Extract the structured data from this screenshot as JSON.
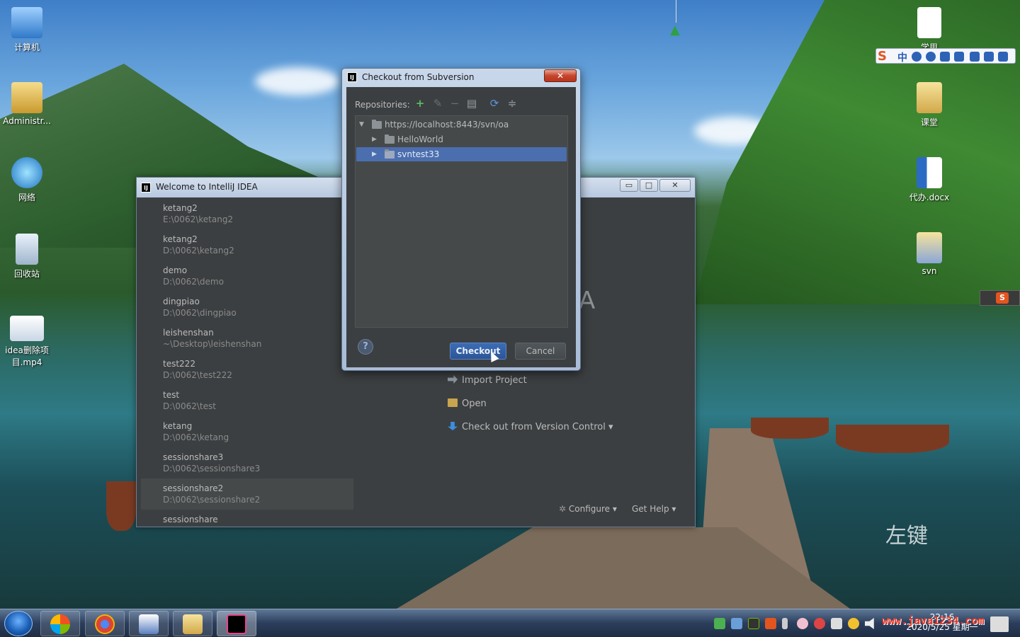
{
  "desktop": {
    "icons": [
      {
        "label": "计算机"
      },
      {
        "label": "Administr..."
      },
      {
        "label": "网络"
      },
      {
        "label": "回收站"
      },
      {
        "label": "idea删除项目.mp4"
      },
      {
        "label": "学用"
      },
      {
        "label": "课堂"
      },
      {
        "label": "代办.docx"
      },
      {
        "label": "svn"
      }
    ],
    "overlay_text": "左键",
    "watermark": "www.java1234.com"
  },
  "ime": {
    "logo": "S",
    "mode": "中"
  },
  "welcome_window": {
    "title": "Welcome to IntelliJ IDEA",
    "logo": "IJ",
    "big_letter": "A",
    "recent_projects": [
      {
        "name": "ketang2",
        "path": "E:\\0062\\ketang2"
      },
      {
        "name": "ketang2",
        "path": "D:\\0062\\ketang2"
      },
      {
        "name": "demo",
        "path": "D:\\0062\\demo"
      },
      {
        "name": "dingpiao",
        "path": "D:\\0062\\dingpiao"
      },
      {
        "name": "leishenshan",
        "path": "~\\Desktop\\leishenshan"
      },
      {
        "name": "test222",
        "path": "D:\\0062\\test222"
      },
      {
        "name": "test",
        "path": "D:\\0062\\test"
      },
      {
        "name": "ketang",
        "path": "D:\\0062\\ketang"
      },
      {
        "name": "sessionshare3",
        "path": "D:\\0062\\sessionshare3"
      },
      {
        "name": "sessionshare2",
        "path": "D:\\0062\\sessionshare2"
      },
      {
        "name": "sessionshare",
        "path": ""
      }
    ],
    "actions": {
      "import_project": "Import Project",
      "open": "Open",
      "checkout_vcs": "Check out from Version Control ▾"
    },
    "footer": {
      "configure": "Configure ▾",
      "get_help": "Get Help ▾"
    }
  },
  "checkout_dialog": {
    "title": "Checkout from Subversion",
    "logo": "IJ",
    "close_glyph": "✕",
    "repositories_label": "Repositories:",
    "tree": {
      "root": "https://localhost:8443/svn/oa",
      "children": [
        {
          "label": "HelloWorld"
        },
        {
          "label": "svntest33"
        }
      ]
    },
    "help_glyph": "?",
    "checkout_label": "Checkout",
    "cancel_label": "Cancel"
  },
  "taskbar": {
    "clock_time": "22:16",
    "clock_date": "2020/5/25 星期一"
  }
}
